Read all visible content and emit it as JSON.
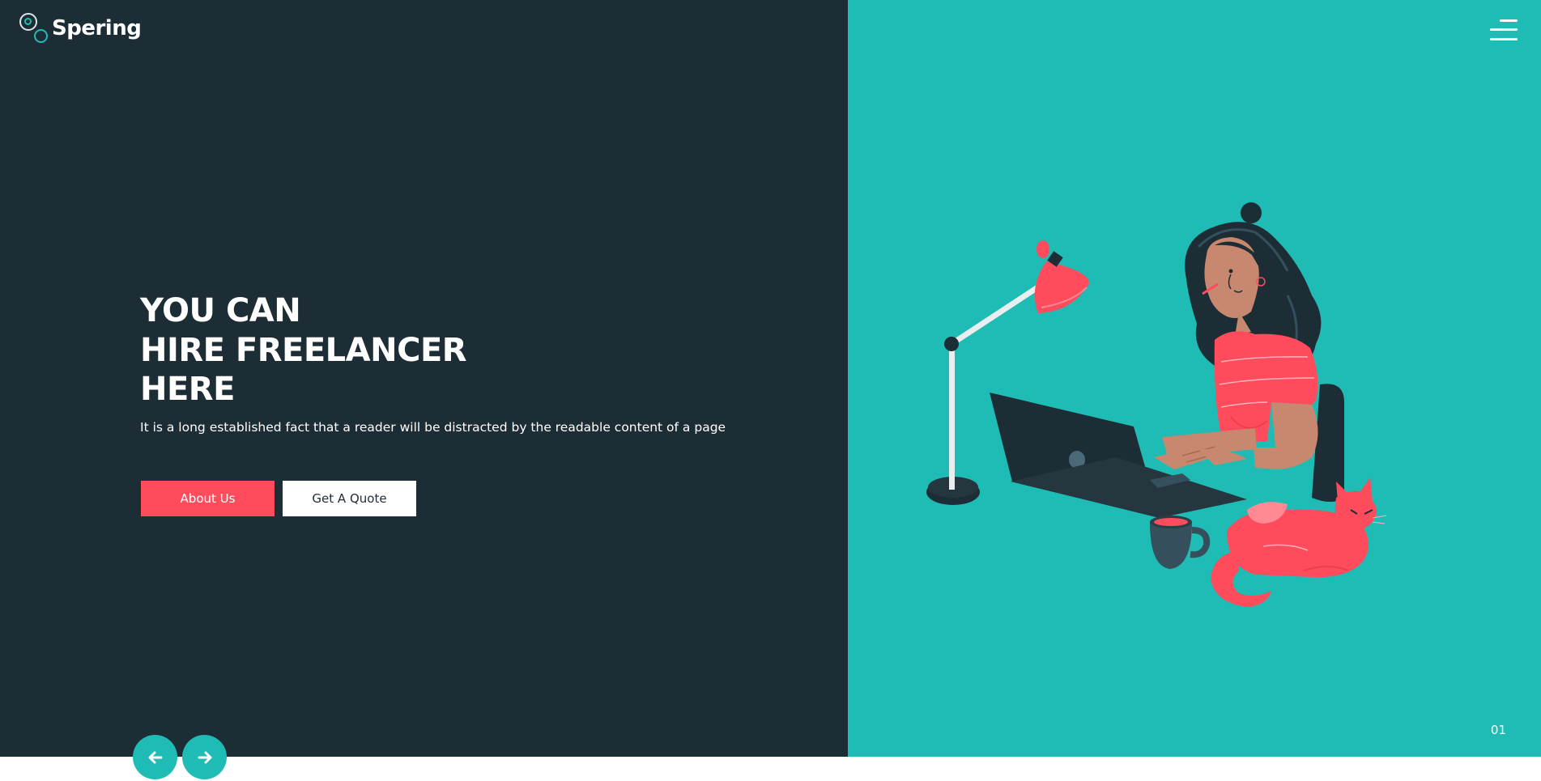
{
  "brand": {
    "name": "Spering"
  },
  "hero": {
    "headline_lines": [
      "YOU CAN",
      "HIRE FREELANCER",
      "HERE"
    ],
    "subtext": "It is a long established fact that a reader will be distracted by the readable content of a page",
    "about_button_label": "About Us",
    "quote_button_label": "Get A Quote"
  },
  "slider": {
    "counter": "01",
    "prev_icon": "arrow-left-icon",
    "next_icon": "arrow-right-icon"
  },
  "header": {
    "menu_icon": "hamburger-menu-icon"
  },
  "colors": {
    "dark_panel": "#1d2d36",
    "teal_accent": "#1ebcb5",
    "coral_accent": "#fe4c5d",
    "white": "#ffffff"
  }
}
